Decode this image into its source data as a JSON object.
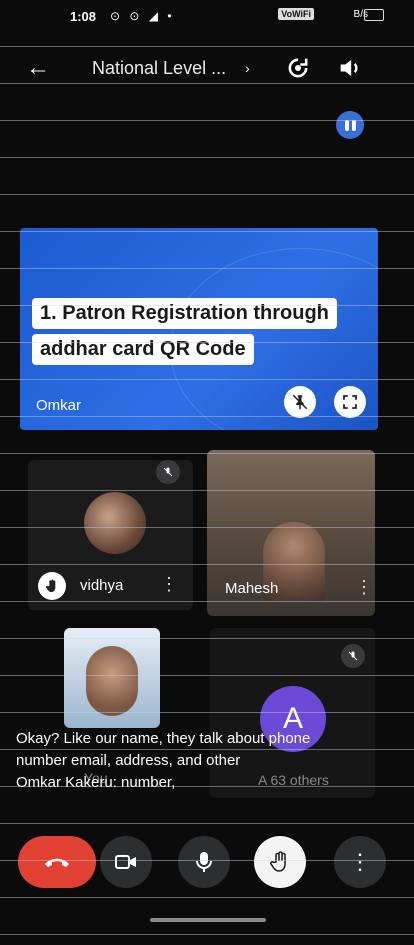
{
  "status_bar": {
    "time": "1:08",
    "left_icons": "⊙ ⊙ ◢ •",
    "network": "VoWiFi",
    "battery_text": "B/s"
  },
  "top_bar": {
    "back_icon": "arrow-back-icon",
    "meeting_title": "National Level ...",
    "chevron": "›",
    "camera_switch_icon": "camera-flip-icon",
    "audio_icon": "speaker-icon"
  },
  "presentation": {
    "slide_line_1": "1. Patron Registration through",
    "slide_line_2": "addhar card QR Code",
    "presenter_name": "Omkar"
  },
  "participants": [
    {
      "name": "vidhya",
      "state": "hand-raised, muted"
    },
    {
      "name": "Mahesh",
      "state": "video on"
    },
    {
      "name": "You",
      "state": "video on"
    },
    {
      "name": "A",
      "label": "A 63 others",
      "state": "muted"
    }
  ],
  "caption": {
    "line1": "Okay? Like our name, they talk about phone",
    "line2": "number email, address, and other",
    "speaker": "Omkar Kakeru:",
    "line3": " number,"
  },
  "under_labels": {
    "you": "You",
    "others": "A 63 others"
  },
  "controls": {
    "end_call": "end-call-icon",
    "camera": "camera-icon",
    "mic": "mic-icon",
    "raise_hand": "raise-hand-icon",
    "more": "more-vertical-icon"
  },
  "colors": {
    "accent_blue": "#2f6ee6",
    "end_call_red": "#e14133",
    "control_bg": "#2d2e30",
    "speaker_indicator": "#3a6fd8"
  }
}
